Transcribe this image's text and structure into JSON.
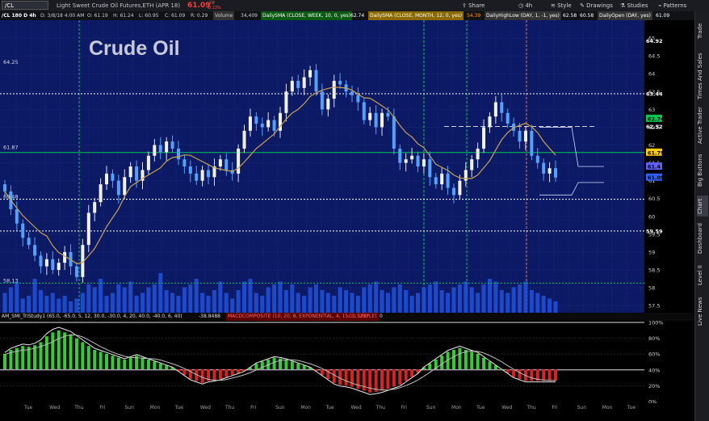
{
  "topbar": {
    "symbol": "/CL",
    "description": "Light Sweet Crude Oil Futures,ETH (APR 18)",
    "last_price": "61.09",
    "change_top": "-.08",
    "change_bottom": "-0.13%",
    "buttons": [
      {
        "label": "Share",
        "icon": "share-icon"
      },
      {
        "label": "4h",
        "icon": "clock-icon"
      },
      {
        "label": "Style",
        "icon": "style-icon"
      },
      {
        "label": "Drawings",
        "icon": "pencil-icon"
      },
      {
        "label": "Studies",
        "icon": "flask-icon"
      },
      {
        "label": "Patterns",
        "icon": "pattern-icon"
      }
    ]
  },
  "infobar": {
    "sym_tf": "/CL 180 D 4h",
    "date": "D: 3/8/18 4:00 AM",
    "open": "O: 61.19",
    "high": "H: 61.24",
    "low": "L: 60.95",
    "close": "C: 61.09",
    "range": "R: 0.29",
    "volume_label": "Volume",
    "volume": "34,409",
    "study1": "DailySMA (CLOSE, WEEK, 10, 0, yes)",
    "study1_value": "62.74",
    "study2": "DailySMA (CLOSE, MONTH, 12, 0, yes)",
    "study2_value": "54.39",
    "study3": "DailyHighLow (DAY, 1, -1, yes)",
    "study3_high": "62.58",
    "study3_low": "60.58",
    "study4": "DailyOpen (DAY, yes)",
    "study4_value": "61.09"
  },
  "sidebar": {
    "tabs": [
      "Trade",
      "Times And Sales",
      "Active Trader",
      "Big Buttons",
      "Chart",
      "Dashboard",
      "Level II",
      "Live News"
    ]
  },
  "title": "Crude Oil",
  "study_bar": {
    "name": "AM_SMI_TriStudy1 (65.0, -65.0, 5, 12, 30.0, -30.0, 4, 20, 40.0, -40.0, 6, 40)",
    "value": "-38.8488",
    "study2": "MACDCOMPOSITE (10, 20, 8, EXPONENTIAL, 4, 15, 3, SIMPLE)",
    "study2_value": "-0.11217",
    "zero": "0"
  },
  "price_axis": {
    "ticks": [
      "65",
      "64.5",
      "64",
      "63.5",
      "63",
      "62.5",
      "62",
      "61.5",
      "61",
      "60.5",
      "60",
      "59.5",
      "59",
      "58.5",
      "58",
      "57.5"
    ],
    "markers": [
      {
        "text": "64.92",
        "color": "#000000",
        "price": 64.92
      },
      {
        "text": "63.44",
        "color": "#000000",
        "price": 63.44
      },
      {
        "text": "62.74",
        "color": "#00c853",
        "price": 62.74
      },
      {
        "text": "62.52",
        "color": "#000000",
        "price": 62.52
      },
      {
        "text": "61.79",
        "color": "#ffcc00",
        "price": 61.79
      },
      {
        "text": "61.4",
        "color": "#6060ff",
        "price": 61.4
      },
      {
        "text": "61.09",
        "color": "#3060ff",
        "price": 61.09
      },
      {
        "text": "59.59",
        "color": "#000000",
        "price": 59.59
      }
    ],
    "left_labels": [
      {
        "text": "64.25",
        "price": 64.25
      },
      {
        "text": "61.87",
        "price": 61.87
      },
      {
        "text": "60.48",
        "price": 60.48
      },
      {
        "text": "58.13",
        "price": 58.13
      }
    ]
  },
  "osc_axis": {
    "ticks": [
      "100%",
      "80%",
      "60%",
      "40%",
      "20%",
      "0%"
    ]
  },
  "time_axis": {
    "labels": [
      "Tue",
      "Wed",
      "Thu",
      "Fri",
      "Sun",
      "Mon",
      "Tue",
      "Wed",
      "Thu",
      "Fri",
      "Sun",
      "Mon",
      "Tue",
      "Wed",
      "Thu",
      "Fri",
      "Sun",
      "Mon",
      "Tue",
      "Wed",
      "Thu",
      "Fri",
      "Sun",
      "Mon",
      "Tue"
    ]
  },
  "chart_data": {
    "type": "candlestick",
    "title": "Crude Oil",
    "ylim": [
      57.3,
      65.5
    ],
    "horizontal_levels": [
      {
        "price": 63.44,
        "color": "#ffffff",
        "style": "dotted"
      },
      {
        "price": 60.48,
        "color": "#ffffff",
        "style": "dotted"
      },
      {
        "price": 59.59,
        "color": "#ffffff",
        "style": "dotted"
      },
      {
        "price": 61.79,
        "color": "#00c853",
        "style": "solid"
      },
      {
        "price": 58.13,
        "color": "#00c853",
        "style": "dotted"
      },
      {
        "price": 62.52,
        "color": "#cccccc",
        "style": "dashed"
      }
    ],
    "closes": [
      60.7,
      60.2,
      59.8,
      59.4,
      59.2,
      58.9,
      58.6,
      58.8,
      58.5,
      58.7,
      59.0,
      58.6,
      58.3,
      59.2,
      60.1,
      60.4,
      60.9,
      61.2,
      61.0,
      60.6,
      61.1,
      61.4,
      61.0,
      61.3,
      61.7,
      62.0,
      61.8,
      62.1,
      61.9,
      61.6,
      61.4,
      61.2,
      61.0,
      61.3,
      61.1,
      61.4,
      61.6,
      61.3,
      61.2,
      61.9,
      62.4,
      62.8,
      62.6,
      62.5,
      62.7,
      62.4,
      62.9,
      63.5,
      63.8,
      63.6,
      63.9,
      64.1,
      63.5,
      63.0,
      63.3,
      63.8,
      63.7,
      63.5,
      63.4,
      63.2,
      62.7,
      62.9,
      62.5,
      62.9,
      62.8,
      61.9,
      61.5,
      61.6,
      61.7,
      61.4,
      61.6,
      61.1,
      60.9,
      61.2,
      60.8,
      60.6,
      61.0,
      61.3,
      61.6,
      61.9,
      62.5,
      62.8,
      63.2,
      62.9,
      62.6,
      62.4,
      62.1,
      62.4,
      61.7,
      61.5,
      61.2,
      61.35,
      61.09
    ],
    "volumes": [
      0.35,
      0.45,
      0.55,
      0.25,
      0.3,
      0.6,
      0.4,
      0.3,
      0.35,
      0.25,
      0.3,
      0.2,
      0.25,
      0.35,
      0.5,
      0.45,
      0.6,
      0.3,
      0.35,
      0.5,
      0.45,
      0.55,
      0.3,
      0.35,
      0.45,
      0.5,
      0.7,
      0.4,
      0.35,
      0.3,
      0.45,
      0.5,
      0.6,
      0.35,
      0.3,
      0.4,
      0.55,
      0.35,
      0.25,
      0.4,
      0.55,
      0.6,
      0.35,
      0.3,
      0.45,
      0.5,
      0.55,
      0.4,
      0.5,
      0.35,
      0.3,
      0.45,
      0.5,
      0.4,
      0.35,
      0.3,
      0.45,
      0.4,
      0.35,
      0.3,
      0.45,
      0.5,
      0.55,
      0.4,
      0.35,
      0.45,
      0.5,
      0.4,
      0.3,
      0.35,
      0.45,
      0.5,
      0.55,
      0.4,
      0.35,
      0.45,
      0.5,
      0.55,
      0.45,
      0.35,
      0.5,
      0.6,
      0.55,
      0.4,
      0.35,
      0.45,
      0.5,
      0.55,
      0.4,
      0.35,
      0.3,
      0.25,
      0.2
    ],
    "macd_hist": [
      0.4,
      0.5,
      0.55,
      0.6,
      0.58,
      0.62,
      0.7,
      0.85,
      0.95,
      1.0,
      0.95,
      0.9,
      0.8,
      0.7,
      0.6,
      0.5,
      0.45,
      0.4,
      0.35,
      0.3,
      0.25,
      0.3,
      0.35,
      0.3,
      0.25,
      0.2,
      0.15,
      0.1,
      0.05,
      -0.05,
      -0.15,
      -0.25,
      -0.3,
      -0.35,
      -0.3,
      -0.28,
      -0.25,
      -0.2,
      -0.15,
      -0.1,
      -0.05,
      0.05,
      0.15,
      0.2,
      0.25,
      0.3,
      0.28,
      0.25,
      0.2,
      0.15,
      0.1,
      0.05,
      -0.05,
      -0.15,
      -0.25,
      -0.35,
      -0.4,
      -0.42,
      -0.45,
      -0.5,
      -0.55,
      -0.6,
      -0.58,
      -0.55,
      -0.5,
      -0.45,
      -0.4,
      -0.3,
      -0.2,
      -0.1,
      0.05,
      0.15,
      0.25,
      0.35,
      0.45,
      0.5,
      0.55,
      0.5,
      0.45,
      0.4,
      0.3,
      0.2,
      0.1,
      0.0,
      -0.1,
      -0.2,
      -0.25,
      -0.3,
      -0.3,
      -0.3,
      -0.3,
      -0.3,
      -0.3
    ]
  }
}
